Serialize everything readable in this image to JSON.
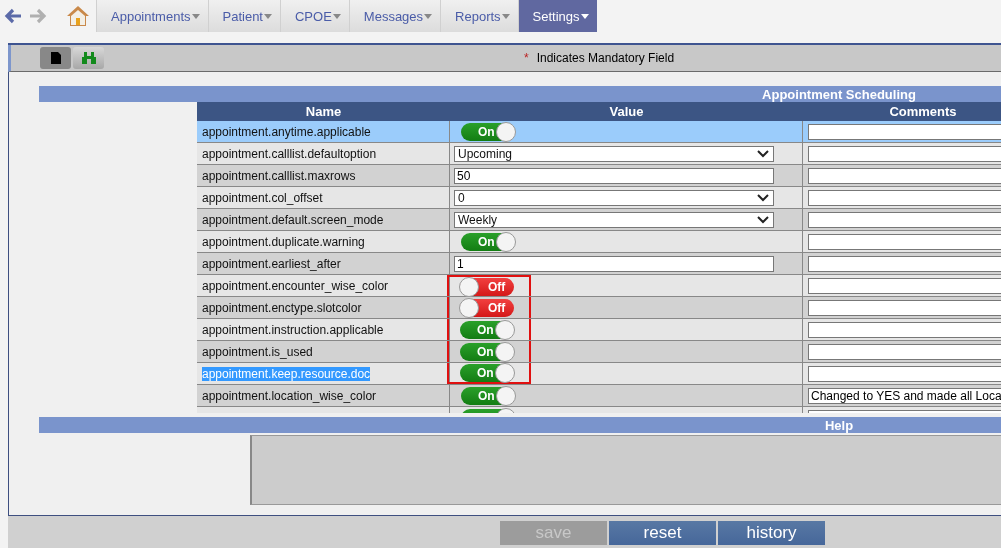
{
  "nav": {
    "back_enabled": true,
    "forward_enabled": false,
    "menus": [
      {
        "label": "Appointments",
        "selected": false
      },
      {
        "label": "Patient",
        "selected": false
      },
      {
        "label": "CPOE",
        "selected": false
      },
      {
        "label": "Messages",
        "selected": false
      },
      {
        "label": "Reports",
        "selected": false
      },
      {
        "label": "Settings",
        "selected": true
      }
    ]
  },
  "toolbar": {
    "mandatory_mark": "*",
    "mandatory_note": "Indicates Mandatory Field"
  },
  "section_title": "Appointment Scheduling",
  "table": {
    "columns": [
      "Name",
      "Value",
      "Comments"
    ],
    "rows": [
      {
        "name": "appointment.anytime.applicable",
        "kind": "toggle",
        "on": true,
        "label": "On",
        "selected": true,
        "boxed": false
      },
      {
        "name": "appointment.calllist.defaultoption",
        "kind": "select",
        "value": "Upcoming",
        "selected": false,
        "boxed": false
      },
      {
        "name": "appointment.calllist.maxrows",
        "kind": "text",
        "value": "50",
        "selected": false,
        "boxed": false
      },
      {
        "name": "appointment.col_offset",
        "kind": "select",
        "value": "0",
        "selected": false,
        "boxed": false
      },
      {
        "name": "appointment.default.screen_mode",
        "kind": "select",
        "value": "Weekly",
        "selected": false,
        "boxed": false
      },
      {
        "name": "appointment.duplicate.warning",
        "kind": "toggle",
        "on": true,
        "label": "On",
        "selected": false,
        "boxed": false
      },
      {
        "name": "appointment.earliest_after",
        "kind": "text",
        "value": "1",
        "selected": false,
        "boxed": false
      },
      {
        "name": "appointment.encounter_wise_color",
        "kind": "toggle",
        "on": false,
        "label": "Off",
        "selected": false,
        "boxed": true
      },
      {
        "name": "appointment.enctype.slotcolor",
        "kind": "toggle",
        "on": false,
        "label": "Off",
        "selected": false,
        "boxed": true
      },
      {
        "name": "appointment.instruction.applicable",
        "kind": "toggle",
        "on": true,
        "label": "On",
        "selected": false,
        "boxed": true
      },
      {
        "name": "appointment.is_used",
        "kind": "toggle",
        "on": true,
        "label": "On",
        "selected": false,
        "boxed": true
      },
      {
        "name": "appointment.keep.resource.doc",
        "kind": "toggle",
        "on": true,
        "label": "On",
        "selected": false,
        "text_highlighted": true,
        "boxed": true
      },
      {
        "name": "appointment.location_wise_color",
        "kind": "toggle",
        "on": true,
        "label": "On",
        "selected": false,
        "boxed": false,
        "comment": "Changed to YES and made all Loca"
      },
      {
        "kind": "toggle",
        "on": true,
        "selected": false,
        "boxed": false
      }
    ]
  },
  "help_title": "Help",
  "buttons": [
    {
      "label": "save",
      "disabled": true
    },
    {
      "label": "reset",
      "disabled": false
    },
    {
      "label": "history",
      "disabled": false
    }
  ]
}
